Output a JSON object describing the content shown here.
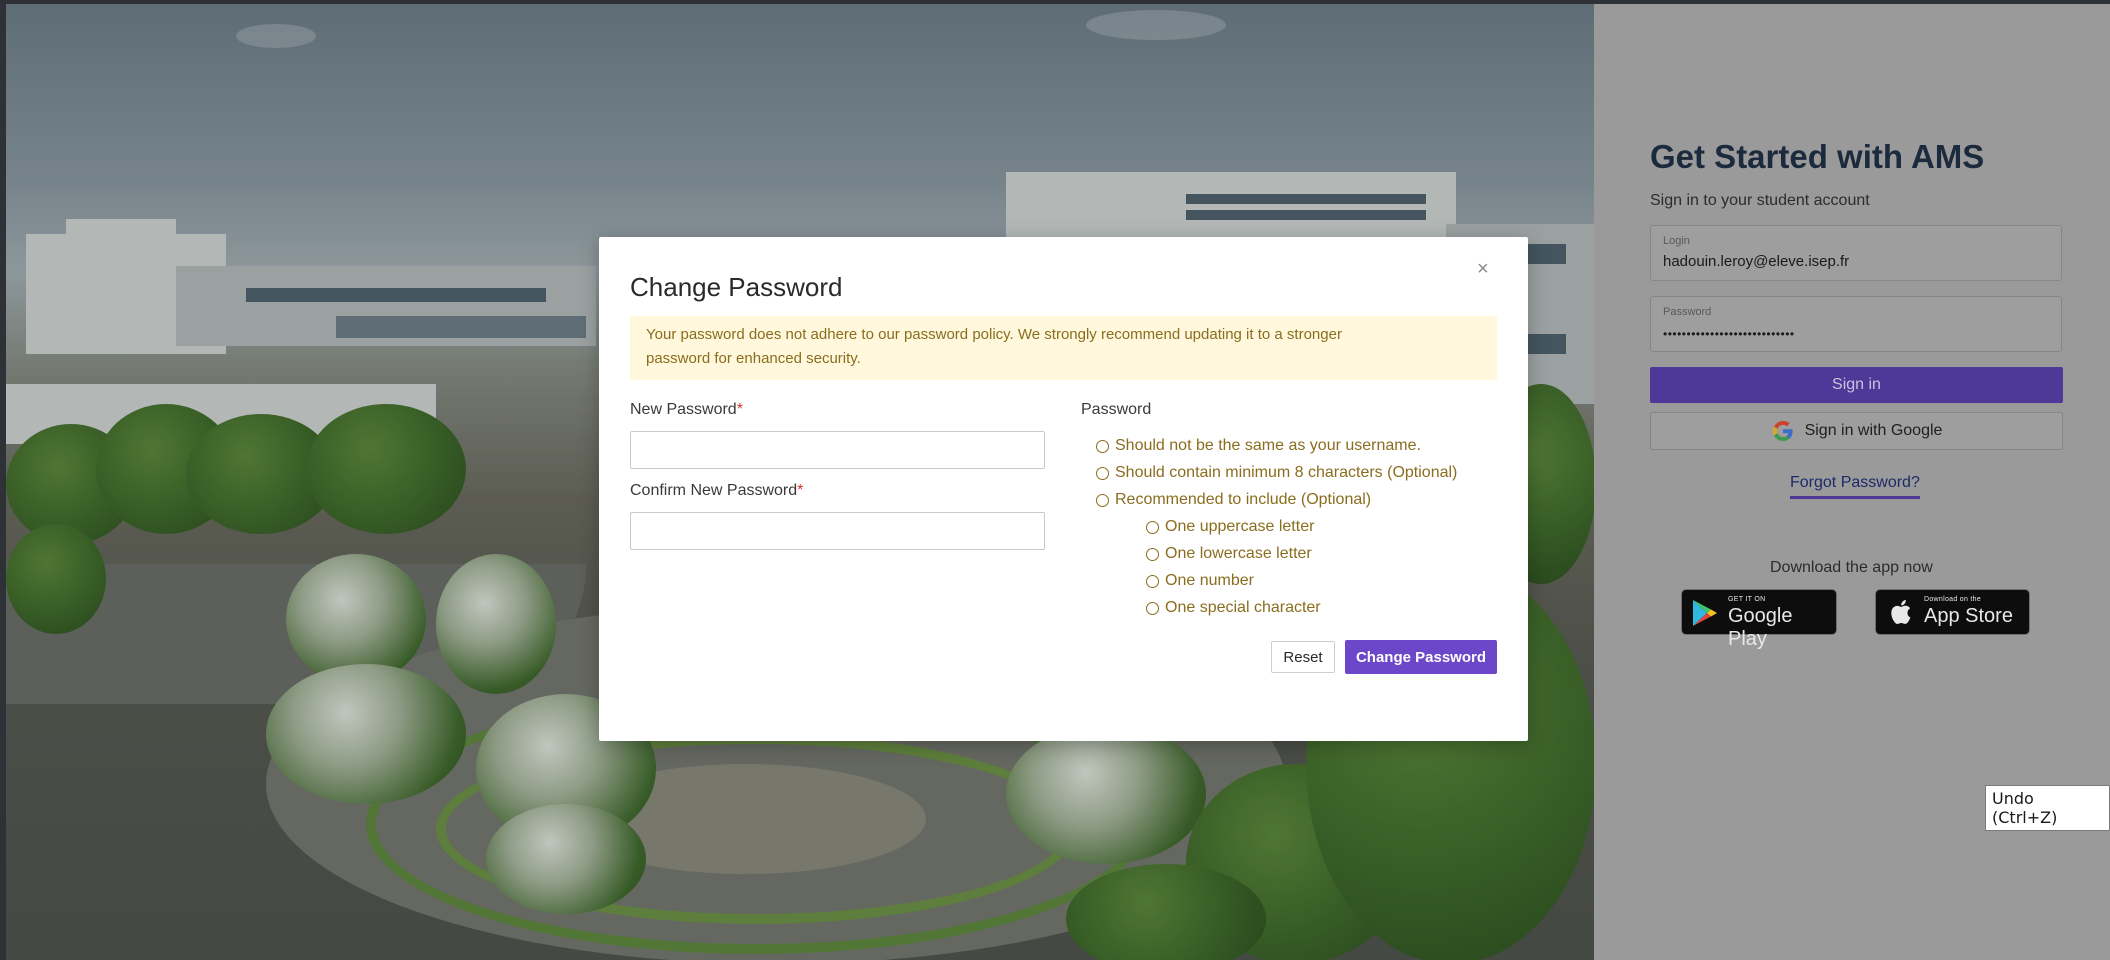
{
  "modal": {
    "title": "Change Password",
    "close_symbol": "×",
    "alert_line1": "Your password does not adhere to our password policy. We strongly recommend updating it to a stronger",
    "alert_line2": "password for enhanced security.",
    "new_password_label": "New Password",
    "confirm_password_label": "Confirm New Password",
    "required_mark": "*",
    "new_password_value": "",
    "confirm_password_value": "",
    "policy_heading": "Password",
    "rules": [
      "Should not be the same as your username.",
      "Should contain minimum 8 characters (Optional)",
      "Recommended to include (Optional)"
    ],
    "sub_rules": [
      "One uppercase letter",
      "One lowercase letter",
      "One number",
      "One special character"
    ],
    "reset_label": "Reset",
    "change_label": "Change Password"
  },
  "signin": {
    "title": "Get Started with AMS",
    "subtitle": "Sign in to your student account",
    "login_label": "Login",
    "login_value": "hadouin.leroy@eleve.isep.fr",
    "password_label": "Password",
    "password_value": "••••••••••••••••••••••••••••",
    "signin_label": "Sign in",
    "google_label": "Sign in with Google",
    "forgot_label": "Forgot Password?",
    "download_label": "Download the app now",
    "google_play_small": "GET IT ON",
    "google_play_big": "Google Play",
    "app_store_small": "Download on the",
    "app_store_big": "App Store"
  },
  "tooltip": {
    "text": "Undo (Ctrl+Z)"
  },
  "colors": {
    "accent": "#6c47c9",
    "signin_button": "#4f3898",
    "alert_bg": "#fff8dc",
    "alert_text": "#8a6d1f",
    "required": "#d0342c"
  },
  "icons": [
    "close-icon",
    "google-icon",
    "google-play-icon",
    "apple-icon",
    "radio-circle-icon"
  ]
}
